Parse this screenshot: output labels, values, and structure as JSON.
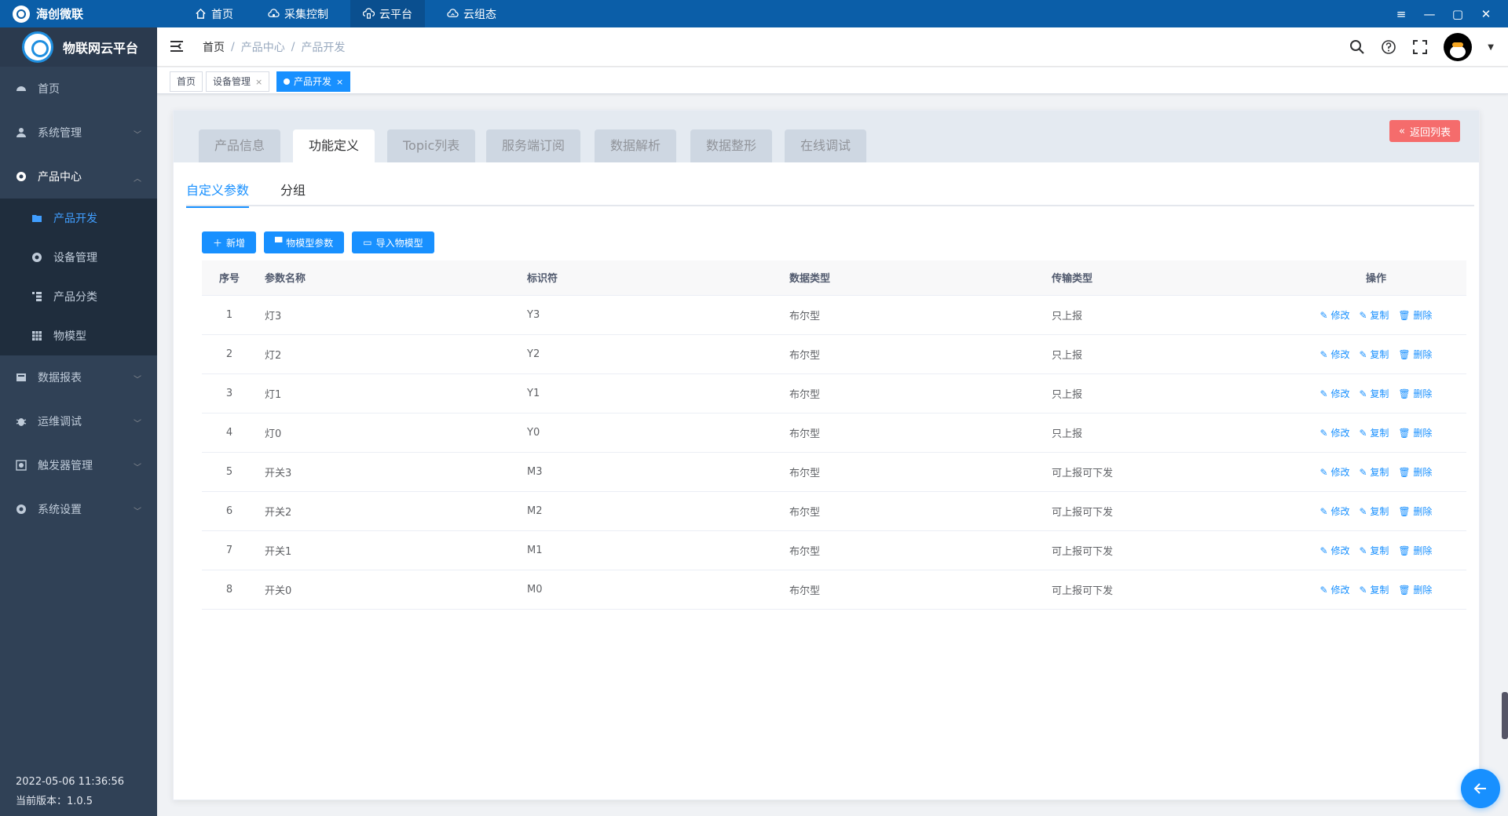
{
  "topbar": {
    "brand": "海创微联",
    "nav": [
      {
        "label": "首页",
        "icon": "home-icon"
      },
      {
        "label": "采集控制",
        "icon": "cloud-gear-icon"
      },
      {
        "label": "云平台",
        "icon": "cloud-building-icon",
        "active": true
      },
      {
        "label": "云组态",
        "icon": "cloud-icon"
      }
    ],
    "window_controls": [
      "≡",
      "—",
      "▢",
      "✕"
    ]
  },
  "sidebar": {
    "title": "物联网云平台",
    "menu": [
      {
        "label": "首页"
      },
      {
        "label": "系统管理"
      },
      {
        "label": "产品中心"
      },
      {
        "label": "产品开发"
      },
      {
        "label": "设备管理"
      },
      {
        "label": "产品分类"
      },
      {
        "label": "物模型"
      },
      {
        "label": "数据报表"
      },
      {
        "label": "运维调试"
      },
      {
        "label": "触发器管理"
      },
      {
        "label": "系统设置"
      }
    ],
    "datetime": "2022-05-06 11:36:56",
    "version": "当前版本：1.0.5"
  },
  "breadcrumb": [
    "首页",
    "/",
    "产品中心",
    "/",
    "产品开发"
  ],
  "tags": [
    {
      "label": "首页"
    },
    {
      "label": "设备管理",
      "close": "×"
    },
    {
      "label": "产品开发",
      "close": "×",
      "active": true
    }
  ],
  "card_tabs": [
    "产品信息",
    "功能定义",
    "Topic列表",
    "服务端订阅",
    "数据解析",
    "数据整形",
    "在线调试"
  ],
  "back_button": "返回列表",
  "sub_tabs": [
    "自定义参数",
    "分组"
  ],
  "actions": {
    "add": "新增",
    "model_params": "物模型参数",
    "import_model": "导入物模型"
  },
  "table": {
    "headers": [
      "序号",
      "参数名称",
      "标识符",
      "数据类型",
      "传输类型",
      "操作"
    ],
    "rows": [
      {
        "idx": "1",
        "name": "灯3",
        "id": "Y3",
        "dtype": "布尔型",
        "ttype": "只上报"
      },
      {
        "idx": "2",
        "name": "灯2",
        "id": "Y2",
        "dtype": "布尔型",
        "ttype": "只上报"
      },
      {
        "idx": "3",
        "name": "灯1",
        "id": "Y1",
        "dtype": "布尔型",
        "ttype": "只上报"
      },
      {
        "idx": "4",
        "name": "灯0",
        "id": "Y0",
        "dtype": "布尔型",
        "ttype": "只上报"
      },
      {
        "idx": "5",
        "name": "开关3",
        "id": "M3",
        "dtype": "布尔型",
        "ttype": "可上报可下发"
      },
      {
        "idx": "6",
        "name": "开关2",
        "id": "M2",
        "dtype": "布尔型",
        "ttype": "可上报可下发"
      },
      {
        "idx": "7",
        "name": "开关1",
        "id": "M1",
        "dtype": "布尔型",
        "ttype": "可上报可下发"
      },
      {
        "idx": "8",
        "name": "开关0",
        "id": "M0",
        "dtype": "布尔型",
        "ttype": "可上报可下发"
      }
    ],
    "ops": {
      "edit": "修改",
      "copy": "复制",
      "delete": "删除"
    }
  }
}
